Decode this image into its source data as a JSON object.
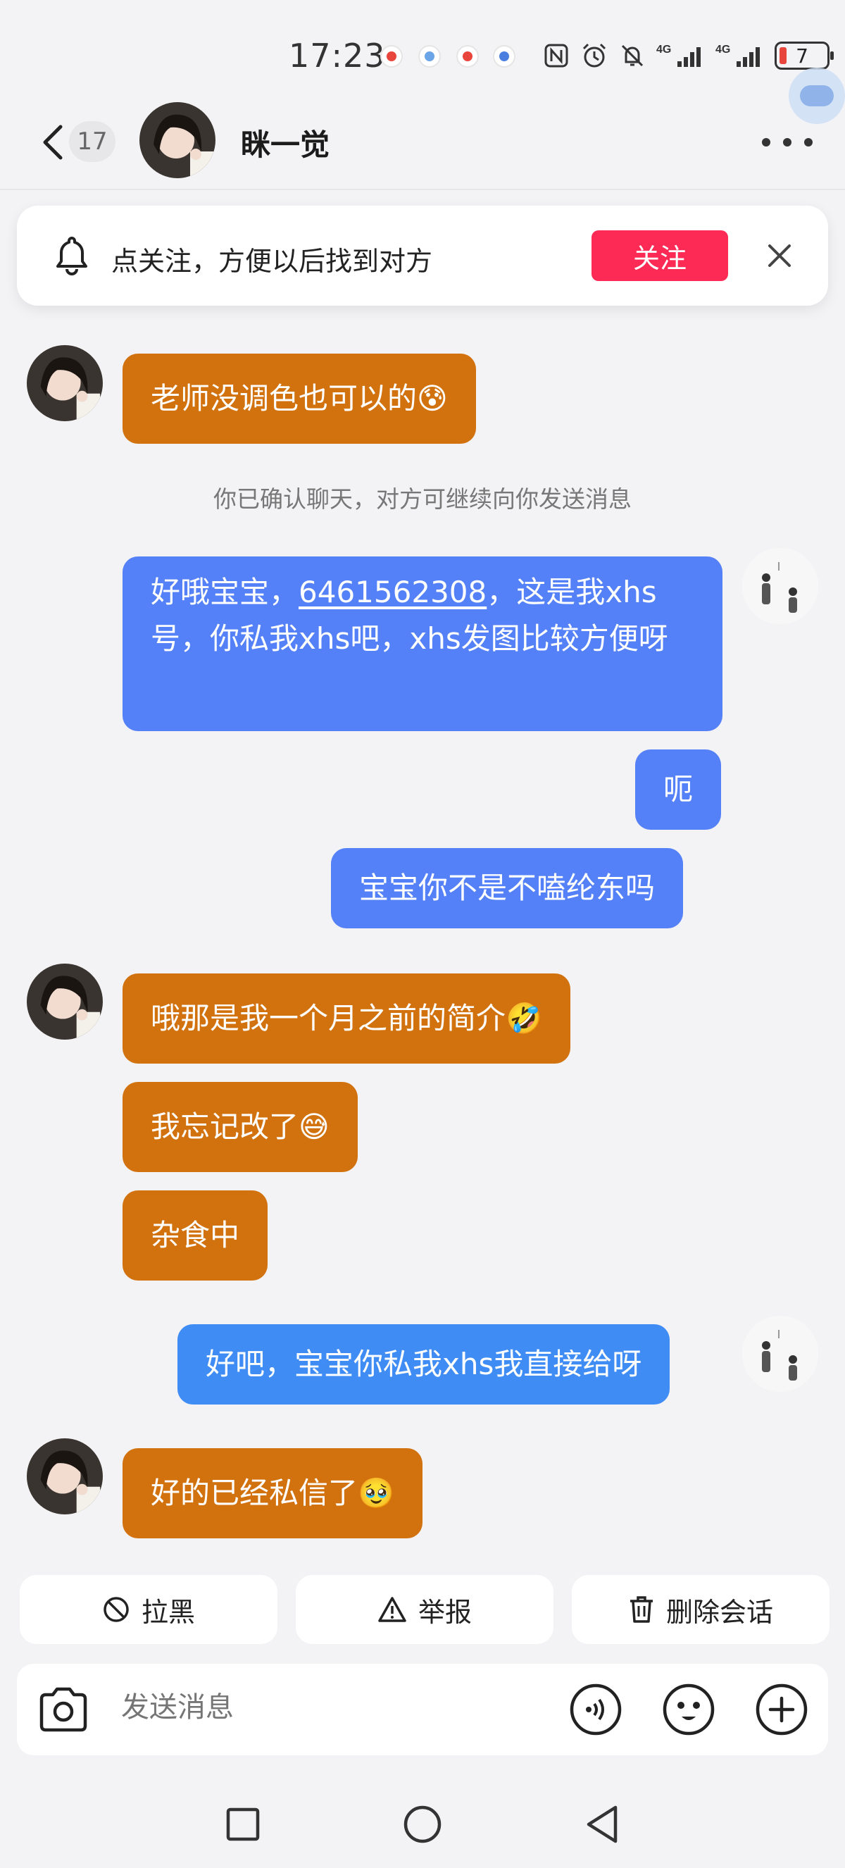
{
  "status_bar": {
    "time": "17:23",
    "network_1": "4G",
    "network_2": "4G",
    "battery_level": "7",
    "icons": [
      "nfc-icon",
      "alarm-icon",
      "mute-icon",
      "signal-icon",
      "signal-icon",
      "battery-icon"
    ]
  },
  "header": {
    "unread_count": "17",
    "contact_name": "眯一觉"
  },
  "follow_banner": {
    "text": "点关注，方便以后找到对方",
    "button_label": "关注"
  },
  "chat": {
    "system_notice": "你已确认聊天，对方可继续向你发送消息",
    "messages": [
      {
        "side": "left",
        "text": "老师没调色也可以的😰"
      },
      {
        "side": "right",
        "text_before": "好哦宝宝，",
        "phone": "6461562308",
        "text_after": "，这是我xhs号，你私我xhs吧，xhs发图比较方便呀"
      },
      {
        "side": "right",
        "text": "呃"
      },
      {
        "side": "right",
        "text": "宝宝你不是不嗑纶东吗"
      },
      {
        "side": "left",
        "text": "哦那是我一个月之前的简介🤣"
      },
      {
        "side": "left",
        "text": "我忘记改了😅"
      },
      {
        "side": "left",
        "text": "杂食中"
      },
      {
        "side": "right",
        "text": "好吧，宝宝你私我xhs我直接给呀"
      },
      {
        "side": "left",
        "text": "好的已经私信了🥹"
      }
    ]
  },
  "actions": {
    "block": "拉黑",
    "report": "举报",
    "delete": "删除会话"
  },
  "input": {
    "placeholder": "发送消息"
  },
  "colors": {
    "incoming_bubble": "#d2720e",
    "outgoing_bubble": "#5480f8",
    "follow_button": "#fd2a55",
    "background": "#f3f3f5"
  }
}
